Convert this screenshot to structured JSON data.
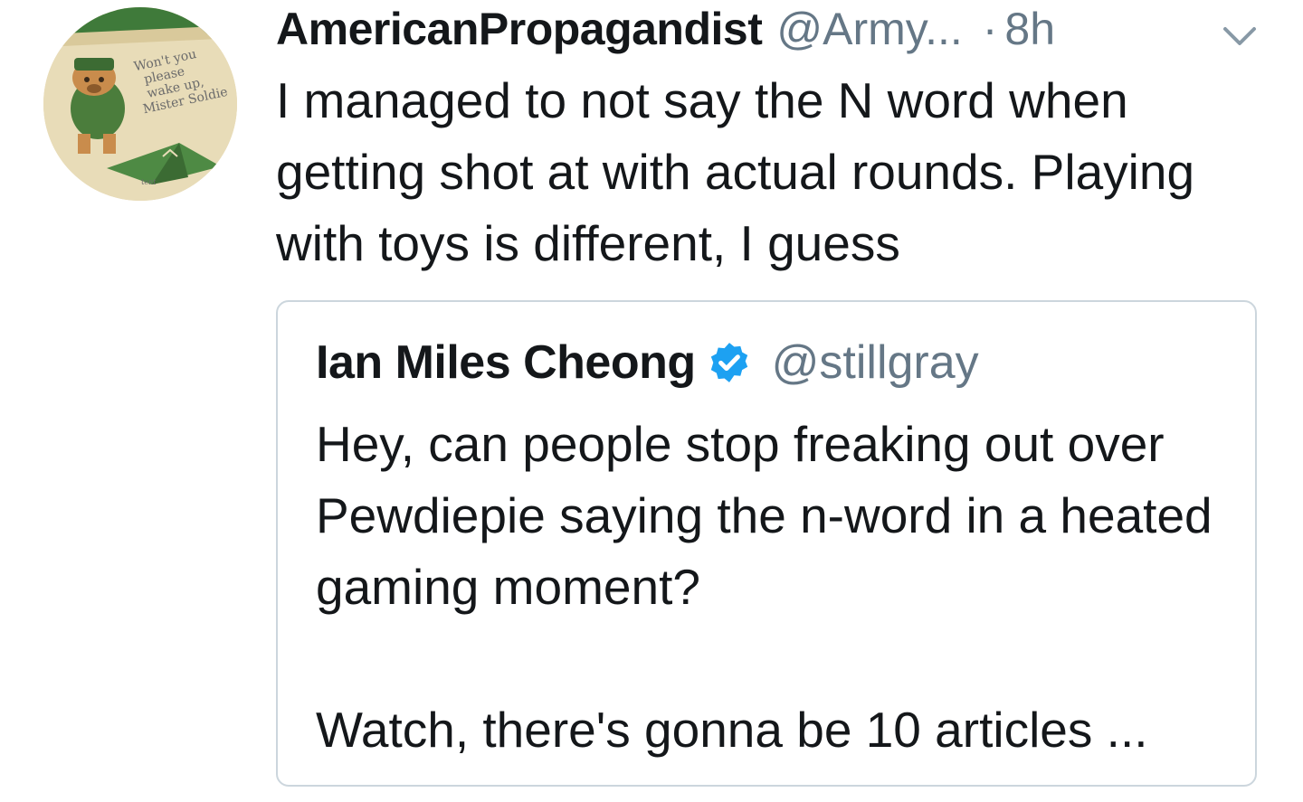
{
  "tweet": {
    "display_name": "AmericanPropagandist",
    "handle": "@Army...",
    "separator": "·",
    "time": "8h",
    "caret_icon": "chevron-down-icon",
    "text": "I managed to not say the N word when getting shot at with actual rounds. Playing with toys is different, I guess",
    "avatar_text": {
      "line1": "Won't you",
      "line2": "please",
      "line3": "wake up,",
      "line4": "Mister Soldie",
      "caption": "tent"
    }
  },
  "quote": {
    "display_name": "Ian Miles Cheong",
    "verified_icon": "verified-badge-icon",
    "handle": "@stillgray",
    "text_line1": "Hey, can people stop freaking out over Pewdiepie saying the n-word in a heated gaming moment?",
    "text_line2": "Watch, there's gonna be 10 articles ..."
  },
  "colors": {
    "primary_text": "#14171a",
    "secondary_text": "#657786",
    "border": "#ccd6dd",
    "verified": "#1da1f2"
  }
}
